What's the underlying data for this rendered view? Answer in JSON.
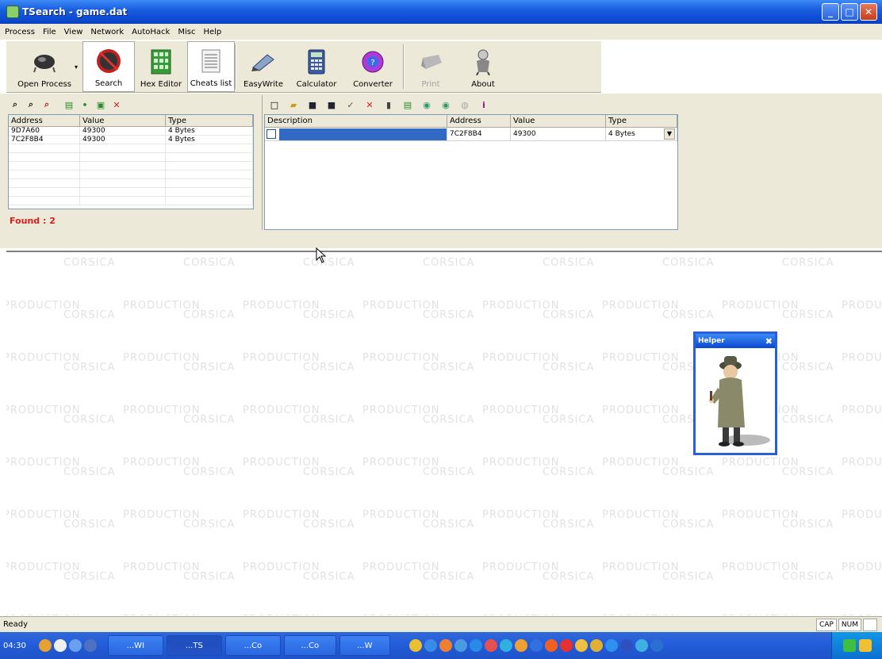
{
  "window": {
    "title": "TSearch - game.dat"
  },
  "menu": [
    "Process",
    "File",
    "View",
    "Network",
    "AutoHack",
    "Misc",
    "Help"
  ],
  "toolbar": [
    {
      "id": "open-process",
      "label": "Open Process"
    },
    {
      "id": "search",
      "label": "Search"
    },
    {
      "id": "hex-editor",
      "label": "Hex Editor"
    },
    {
      "id": "cheats-list",
      "label": "Cheats list"
    },
    {
      "id": "easywrite",
      "label": "EasyWrite"
    },
    {
      "id": "calculator",
      "label": "Calculator"
    },
    {
      "id": "converter",
      "label": "Converter"
    },
    {
      "id": "print",
      "label": "Print"
    },
    {
      "id": "about",
      "label": "About"
    }
  ],
  "search_results": {
    "columns": [
      "Address",
      "Value",
      "Type"
    ],
    "rows": [
      {
        "address": "9D7A60",
        "value": "49300",
        "type": "4 Bytes"
      },
      {
        "address": "7C2F8B4",
        "value": "49300",
        "type": "4 Bytes"
      }
    ],
    "found_label": "Found : 2"
  },
  "cheats": {
    "columns": [
      "Description",
      "Address",
      "Value",
      "Type"
    ],
    "rows": [
      {
        "description": "",
        "address": "7C2F8B4",
        "value": "49300",
        "type": "4 Bytes"
      }
    ]
  },
  "watermark": {
    "line1": "CORSICA",
    "line2": "PRODUCTION"
  },
  "helper": {
    "title": "Helper"
  },
  "status": {
    "text": "Ready",
    "cap": "CAP",
    "num": "NUM"
  },
  "taskbar": {
    "clock": "04:30",
    "items": [
      "...WI",
      "...TS",
      "...Co",
      "...Co",
      "...W"
    ]
  },
  "colors": {
    "title_blue": "#0a48d0",
    "found_red": "#d42020",
    "selection_blue": "#316ac5"
  }
}
